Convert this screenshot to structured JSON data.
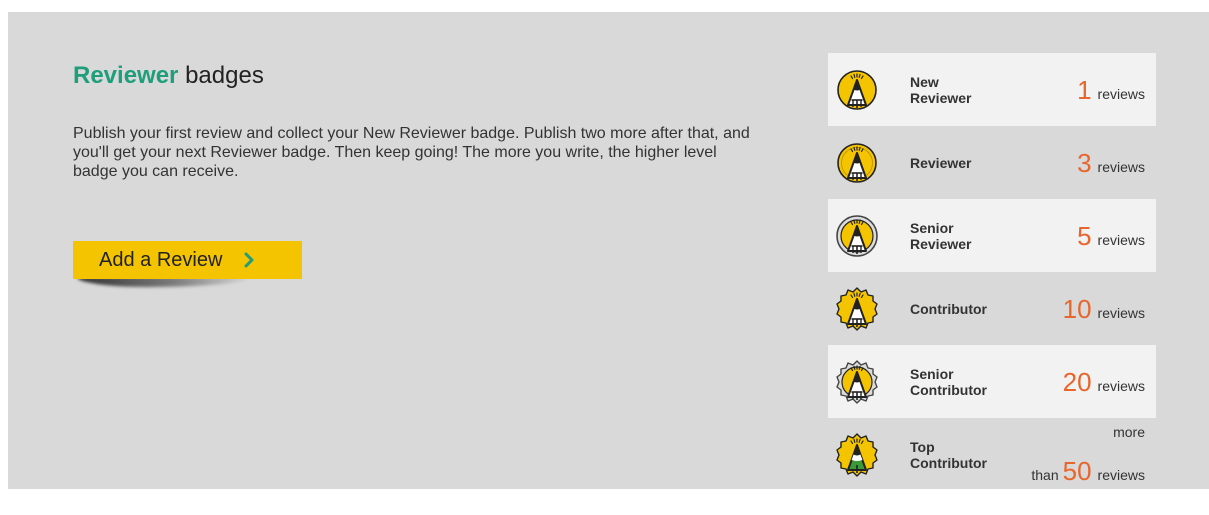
{
  "heading": {
    "accent": "Reviewer",
    "rest": "badges"
  },
  "description": "Publish your first review and collect your New Reviewer badge. Publish two more after that, and you'll get your next Reviewer badge. Then keep going! The more you write, the higher level badge you can receive.",
  "cta": {
    "label": "Add a Review",
    "icon": "chevron-right-icon",
    "color": "#f5c400"
  },
  "colors": {
    "accent": "#1f9e7b",
    "count": "#e8652b",
    "panel": "#d9d9d9",
    "row_alt": "#f2f2f2"
  },
  "badges": [
    {
      "line1": "New",
      "line2": "Reviewer",
      "count": "1",
      "unit": "reviews",
      "icon": "new-reviewer-badge-icon"
    },
    {
      "line1": "Reviewer",
      "line2": "",
      "count": "3",
      "unit": "reviews",
      "icon": "reviewer-badge-icon"
    },
    {
      "line1": "Senior",
      "line2": "Reviewer",
      "count": "5",
      "unit": "reviews",
      "icon": "senior-reviewer-badge-icon"
    },
    {
      "line1": "Contributor",
      "line2": "",
      "count": "10",
      "unit": "reviews",
      "icon": "contributor-badge-icon"
    },
    {
      "line1": "Senior",
      "line2": "Contributor",
      "count": "20",
      "unit": "reviews",
      "icon": "senior-contributor-badge-icon"
    },
    {
      "line1": "Top",
      "line2": "Contributor",
      "prefix_top": "more",
      "prefix": "than",
      "count": "50",
      "unit": "reviews",
      "icon": "top-contributor-badge-icon"
    }
  ]
}
